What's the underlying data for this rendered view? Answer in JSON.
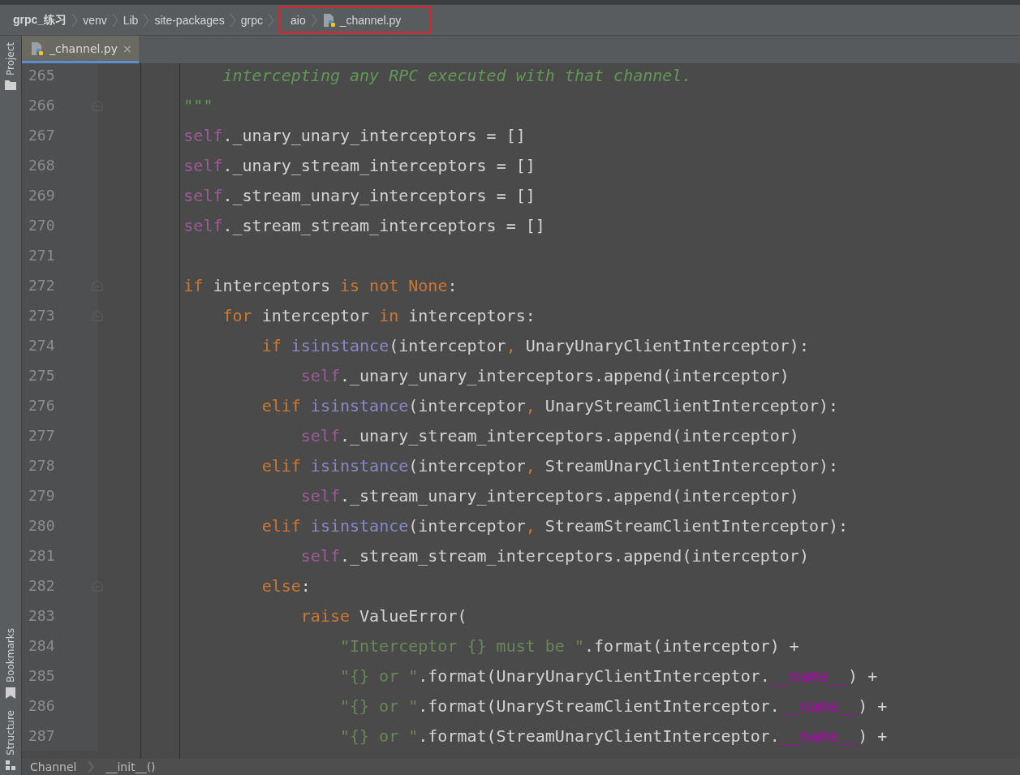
{
  "breadcrumbs": [
    {
      "label": "grpc_练习",
      "bold": true,
      "file": false,
      "highlighted": false
    },
    {
      "label": "venv",
      "bold": false,
      "file": false,
      "highlighted": false
    },
    {
      "label": "Lib",
      "bold": false,
      "file": false,
      "highlighted": false
    },
    {
      "label": "site-packages",
      "bold": false,
      "file": false,
      "highlighted": false
    },
    {
      "label": "grpc",
      "bold": false,
      "file": false,
      "highlighted": false
    },
    {
      "label": "aio",
      "bold": false,
      "file": false,
      "highlighted": true
    },
    {
      "label": "_channel.py",
      "bold": false,
      "file": true,
      "highlighted": true
    }
  ],
  "tool_stripe": [
    {
      "label": "Project",
      "kind": "folder"
    },
    {
      "label": "Bookmarks",
      "kind": "bookmark"
    },
    {
      "label": "Structure",
      "kind": "structure"
    }
  ],
  "tabs": [
    {
      "label": "_channel.py",
      "selected": true,
      "close": "×"
    }
  ],
  "lines": [
    {
      "number": "265",
      "fold": false,
      "tokens": [
        {
          "kind": "doc",
          "text": "            intercepting any RPC executed with that channel."
        }
      ]
    },
    {
      "number": "266",
      "fold": true,
      "tokens": [
        {
          "kind": "doc",
          "text": "        \"\"\""
        }
      ]
    },
    {
      "number": "267",
      "fold": false,
      "tokens": [
        {
          "kind": "self",
          "text": "        self"
        },
        {
          "kind": "plain",
          "text": "._unary_unary_interceptors = []"
        }
      ]
    },
    {
      "number": "268",
      "fold": false,
      "tokens": [
        {
          "kind": "self",
          "text": "        self"
        },
        {
          "kind": "plain",
          "text": "._unary_stream_interceptors = []"
        }
      ]
    },
    {
      "number": "269",
      "fold": false,
      "tokens": [
        {
          "kind": "self",
          "text": "        self"
        },
        {
          "kind": "plain",
          "text": "._stream_unary_interceptors = []"
        }
      ]
    },
    {
      "number": "270",
      "fold": false,
      "tokens": [
        {
          "kind": "self",
          "text": "        self"
        },
        {
          "kind": "plain",
          "text": "._stream_stream_interceptors = []"
        }
      ]
    },
    {
      "number": "271",
      "fold": false
    },
    {
      "number": "272",
      "fold": true,
      "tokens": [
        {
          "kind": "kw",
          "text": "        if"
        },
        {
          "kind": "plain",
          "text": " interceptors "
        },
        {
          "kind": "kw",
          "text": "is not None"
        },
        {
          "kind": "plain",
          "text": ":"
        }
      ]
    },
    {
      "number": "273",
      "fold": true,
      "tokens": [
        {
          "kind": "kw",
          "text": "            for"
        },
        {
          "kind": "plain",
          "text": " interceptor "
        },
        {
          "kind": "kw",
          "text": "in"
        },
        {
          "kind": "plain",
          "text": " interceptors:"
        }
      ]
    },
    {
      "number": "274",
      "fold": false,
      "tokens": [
        {
          "kind": "kw",
          "text": "                if"
        },
        {
          "kind": "builtin",
          "text": " isinstance"
        },
        {
          "kind": "plain",
          "text": "(interceptor"
        },
        {
          "kind": "comma",
          "text": ","
        },
        {
          "kind": "plain",
          "text": " UnaryUnaryClientInterceptor):"
        }
      ]
    },
    {
      "number": "275",
      "fold": false,
      "tokens": [
        {
          "kind": "self",
          "text": "                    self"
        },
        {
          "kind": "plain",
          "text": "._unary_unary_interceptors.append(interceptor)"
        }
      ]
    },
    {
      "number": "276",
      "fold": false,
      "tokens": [
        {
          "kind": "kw",
          "text": "                elif"
        },
        {
          "kind": "builtin",
          "text": " isinstance"
        },
        {
          "kind": "plain",
          "text": "(interceptor"
        },
        {
          "kind": "comma",
          "text": ","
        },
        {
          "kind": "plain",
          "text": " UnaryStreamClientInterceptor):"
        }
      ]
    },
    {
      "number": "277",
      "fold": false,
      "tokens": [
        {
          "kind": "self",
          "text": "                    self"
        },
        {
          "kind": "plain",
          "text": "._unary_stream_interceptors.append(interceptor)"
        }
      ]
    },
    {
      "number": "278",
      "fold": false,
      "tokens": [
        {
          "kind": "kw",
          "text": "                elif"
        },
        {
          "kind": "builtin",
          "text": " isinstance"
        },
        {
          "kind": "plain",
          "text": "(interceptor"
        },
        {
          "kind": "comma",
          "text": ","
        },
        {
          "kind": "plain",
          "text": " StreamUnaryClientInterceptor):"
        }
      ]
    },
    {
      "number": "279",
      "fold": false,
      "tokens": [
        {
          "kind": "self",
          "text": "                    self"
        },
        {
          "kind": "plain",
          "text": "._stream_unary_interceptors.append(interceptor)"
        }
      ]
    },
    {
      "number": "280",
      "fold": false,
      "tokens": [
        {
          "kind": "kw",
          "text": "                elif"
        },
        {
          "kind": "builtin",
          "text": " isinstance"
        },
        {
          "kind": "plain",
          "text": "(interceptor"
        },
        {
          "kind": "comma",
          "text": ","
        },
        {
          "kind": "plain",
          "text": " StreamStreamClientInterceptor):"
        }
      ]
    },
    {
      "number": "281",
      "fold": false,
      "tokens": [
        {
          "kind": "self",
          "text": "                    self"
        },
        {
          "kind": "plain",
          "text": "._stream_stream_interceptors.append(interceptor)"
        }
      ]
    },
    {
      "number": "282",
      "fold": true,
      "tokens": [
        {
          "kind": "kw",
          "text": "                else"
        },
        {
          "kind": "plain",
          "text": ":"
        }
      ]
    },
    {
      "number": "283",
      "fold": false,
      "tokens": [
        {
          "kind": "kw",
          "text": "                    raise"
        },
        {
          "kind": "plain",
          "text": " ValueError("
        }
      ]
    },
    {
      "number": "284",
      "fold": false,
      "tokens": [
        {
          "kind": "str",
          "text": "                        \"Interceptor {} must be \""
        },
        {
          "kind": "plain",
          "text": ".format(interceptor) +"
        }
      ]
    },
    {
      "number": "285",
      "fold": false,
      "tokens": [
        {
          "kind": "str",
          "text": "                        \"{} or \""
        },
        {
          "kind": "plain",
          "text": ".format(UnaryUnaryClientInterceptor."
        },
        {
          "kind": "dunder",
          "text": "__name__"
        },
        {
          "kind": "plain",
          "text": ") +"
        }
      ]
    },
    {
      "number": "286",
      "fold": false,
      "tokens": [
        {
          "kind": "str",
          "text": "                        \"{} or \""
        },
        {
          "kind": "plain",
          "text": ".format(UnaryStreamClientInterceptor."
        },
        {
          "kind": "dunder",
          "text": "__name__"
        },
        {
          "kind": "plain",
          "text": ") +"
        }
      ]
    },
    {
      "number": "287",
      "fold": false,
      "tokens": [
        {
          "kind": "str",
          "text": "                        \"{} or \""
        },
        {
          "kind": "plain",
          "text": ".format(StreamUnaryClientInterceptor."
        },
        {
          "kind": "dunder",
          "text": "__name__"
        },
        {
          "kind": "plain",
          "text": ") +"
        }
      ]
    }
  ],
  "status_bar": {
    "breadcrumbs": [
      "Channel",
      "__init__()"
    ]
  }
}
